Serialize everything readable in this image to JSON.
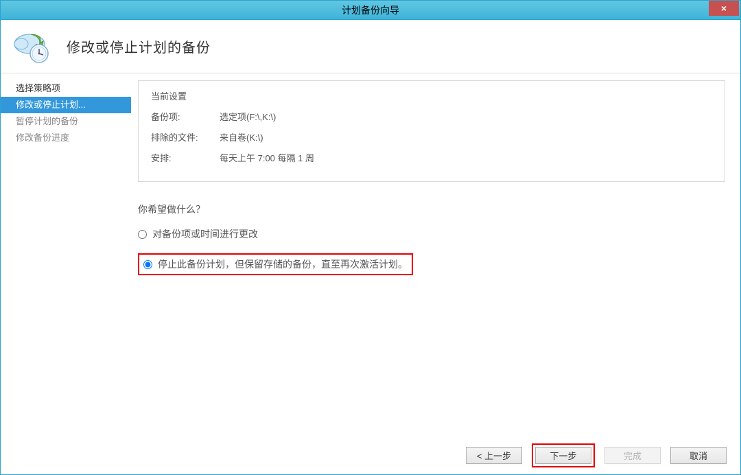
{
  "titlebar": {
    "title": "计划备份向导",
    "close": "×"
  },
  "header": {
    "title": "修改或停止计划的备份"
  },
  "sidebar": {
    "items": [
      {
        "label": "选择策略项",
        "state": "active"
      },
      {
        "label": "修改或停止计划...",
        "state": "selected"
      },
      {
        "label": "暂停计划的备份",
        "state": "disabled"
      },
      {
        "label": "修改备份进度",
        "state": "disabled"
      }
    ]
  },
  "content": {
    "settings_title": "当前设置",
    "rows": [
      {
        "label": "备份项:",
        "value": "选定项(F:\\,K:\\)"
      },
      {
        "label": "排除的文件:",
        "value": "来自卷(K:\\)"
      },
      {
        "label": "安排:",
        "value": "每天上午 7:00 每隔 1 周"
      }
    ],
    "question": "你希望做什么？",
    "options": [
      {
        "label": "对备份项或时间进行更改",
        "selected": false
      },
      {
        "label": "停止此备份计划，但保留存储的备份，直至再次激活计划。",
        "selected": true,
        "highlighted": true
      }
    ]
  },
  "footer": {
    "back": "< 上一步",
    "next": "下一步",
    "finish": "完成",
    "cancel": "取消"
  }
}
